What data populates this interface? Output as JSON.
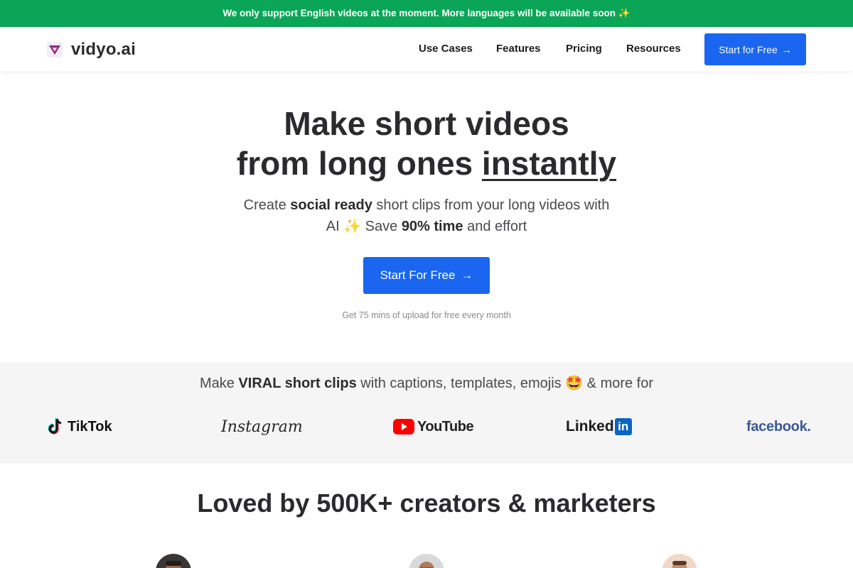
{
  "banner": {
    "text": "We only support English videos at the moment. More languages will be available soon ✨"
  },
  "nav": {
    "logo_text": "vidyo.ai",
    "links": [
      "Use Cases",
      "Features",
      "Pricing",
      "Resources"
    ],
    "cta_label": "Start for Free",
    "cta_icon": "arrow-right-icon"
  },
  "hero": {
    "title_line1": "Make short videos",
    "title_line2_prefix": "from long ones ",
    "title_line2_emphasis": "instantly",
    "sub_part1": "Create ",
    "sub_bold1": "social ready",
    "sub_part2": " short clips from your long videos with AI ✨ Save ",
    "sub_bold2": "90% time",
    "sub_part3": " and effort",
    "cta_label": "Start For Free",
    "note": "Get 75 mins of upload for free every month"
  },
  "platforms": {
    "heading_part1": "Make ",
    "heading_bold": "VIRAL short clips",
    "heading_part2": " with captions, templates, emojis 🤩 & more for",
    "logos": {
      "tiktok": "TikTok",
      "instagram": "Instagram",
      "youtube": "YouTube",
      "linkedin_text": "Linked",
      "linkedin_box": "in",
      "facebook": "facebook."
    }
  },
  "social_proof": {
    "heading": "Loved by 500K+ creators & marketers"
  },
  "colors": {
    "banner_bg": "#0aa556",
    "primary": "#1a66f0",
    "section_bg": "#f5f5f5",
    "text_dark": "#2b2b2e"
  }
}
